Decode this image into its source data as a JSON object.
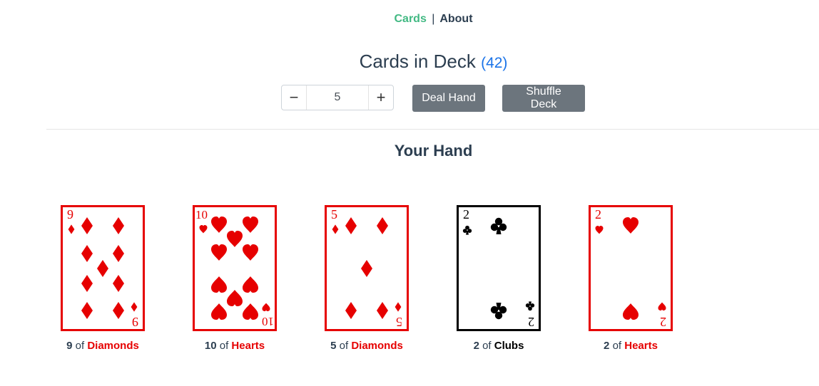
{
  "nav": {
    "cards": "Cards",
    "separator": "|",
    "about": "About"
  },
  "header": {
    "title": "Cards in Deck",
    "count": "(42)"
  },
  "controls": {
    "hand_size": "5",
    "minus": "−",
    "plus": "+",
    "deal": "Deal Hand",
    "shuffle": "Shuffle Deck"
  },
  "hand": {
    "title": "Your Hand",
    "cards": [
      {
        "rank": "9",
        "of": "of",
        "suit": "Diamonds"
      },
      {
        "rank": "10",
        "of": "of",
        "suit": "Hearts"
      },
      {
        "rank": "5",
        "of": "of",
        "suit": "Diamonds"
      },
      {
        "rank": "2",
        "of": "of",
        "suit": "Clubs"
      },
      {
        "rank": "2",
        "of": "of",
        "suit": "Hearts"
      }
    ]
  },
  "colors": {
    "red_suit": "#e60000",
    "black_suit": "#000000",
    "active_link": "#42b983",
    "count": "#1a73e8",
    "button": "#6c757d"
  }
}
